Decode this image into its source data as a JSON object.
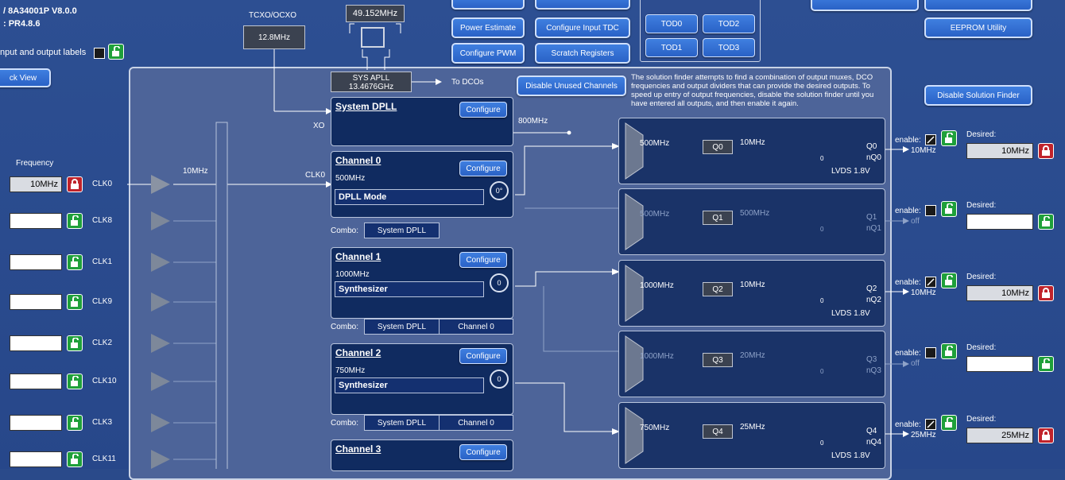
{
  "header": {
    "version": "/ 8A34001P V8.0.0",
    "revision": ": PR4.8.6",
    "labels_toggle": "nput and output labels",
    "back_view": "ck View"
  },
  "top_buttons": {
    "power": "Power Estimate",
    "tdc": "Configure Input TDC",
    "pwm": "Configure PWM",
    "scratch": "Scratch Registers",
    "tod0": "TOD0",
    "tod2": "TOD2",
    "tod1": "TOD1",
    "tod3": "TOD3",
    "eeprom": "EEPROM Utility",
    "disable_unused": "Disable Unused Channels",
    "disable_solution": "Disable Solution Finder"
  },
  "oscillator": {
    "label": "TCXO/OCXO",
    "freq": "12.8MHz",
    "xtal_freq": "49.152MHz"
  },
  "apll": {
    "name": "SYS APLL",
    "freq": "13.4676GHz",
    "to_dcos": "To DCOs"
  },
  "solution_note": "The solution finder attempts to find a combination of output muxes, DCO frequencies and output dividers that can provide the desired outputs. To speed up entry of output frequencies, disable the solution finder until you have entered all outputs, and then enable it again.",
  "inputs": {
    "frequency_label": "Frequency",
    "clk0_value": "10MHz",
    "mux_freq": "10MHz",
    "clk_names": [
      "CLK0",
      "CLK8",
      "CLK1",
      "CLK9",
      "CLK2",
      "CLK10",
      "CLK3",
      "CLK11"
    ]
  },
  "dpll": {
    "title": "System DPLL",
    "configure": "Configure",
    "xo": "XO",
    "out_freq": "800MHz"
  },
  "channels": [
    {
      "title": "Channel 0",
      "freq": "500MHz",
      "mode": "DPLL Mode",
      "phase": "0°",
      "clk_label": "CLK0",
      "combo": [
        "System DPLL"
      ]
    },
    {
      "title": "Channel 1",
      "freq": "1000MHz",
      "mode": "Synthesizer",
      "phase": "0",
      "combo": [
        "System DPLL",
        "Channel 0"
      ]
    },
    {
      "title": "Channel 2",
      "freq": "750MHz",
      "mode": "Synthesizer",
      "phase": "0",
      "combo": [
        "System DPLL",
        "Channel 0"
      ]
    },
    {
      "title": "Channel 3"
    }
  ],
  "combo_label": "Combo:",
  "outputs": [
    {
      "mux_freq": "500MHz",
      "q": "Q0",
      "div_freq": "10MHz",
      "p": "Q0",
      "n": "nQ0",
      "std": "LVDS 1.8V",
      "out": "10MHz",
      "desired": "10MHz"
    },
    {
      "mux_freq": "500MHz",
      "q": "Q1",
      "div_freq": "500MHz",
      "p": "Q1",
      "n": "nQ1",
      "out": "off",
      "desired": ""
    },
    {
      "mux_freq": "1000MHz",
      "q": "Q2",
      "div_freq": "10MHz",
      "p": "Q2",
      "n": "nQ2",
      "std": "LVDS 1.8V",
      "out": "10MHz",
      "desired": "10MHz"
    },
    {
      "mux_freq": "1000MHz",
      "q": "Q3",
      "div_freq": "20MHz",
      "p": "Q3",
      "n": "nQ3",
      "out": "off",
      "desired": ""
    },
    {
      "mux_freq": "750MHz",
      "q": "Q4",
      "div_freq": "25MHz",
      "p": "Q4",
      "n": "nQ4",
      "std": "LVDS 1.8V",
      "out": "25MHz",
      "desired": "25MHz"
    }
  ],
  "right": {
    "enable": "enable:",
    "desired": "Desired:"
  },
  "colors": {
    "bg": "#2a4a8a",
    "button": "#3170d8",
    "lock_green": "#1fa03a",
    "lock_red": "#c0232b"
  }
}
